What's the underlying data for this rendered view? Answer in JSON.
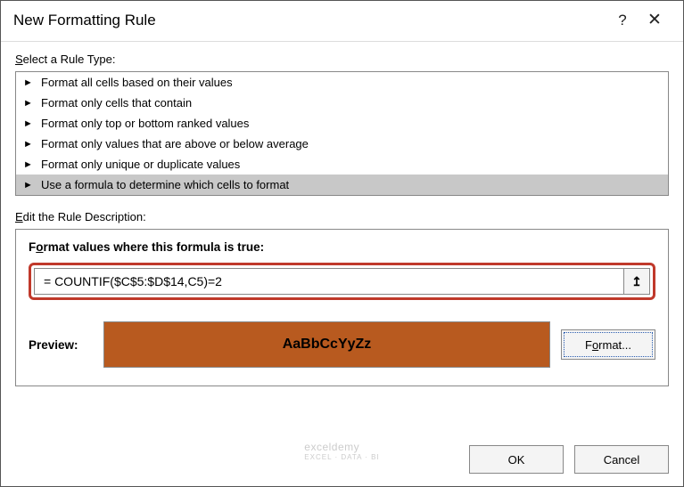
{
  "dialog": {
    "title": "New Formatting Rule",
    "help_symbol": "?",
    "close_symbol": "✕"
  },
  "rule_type": {
    "label_pre": "S",
    "label_post": "elect a Rule Type:",
    "items": [
      "Format all cells based on their values",
      "Format only cells that contain",
      "Format only top or bottom ranked values",
      "Format only values that are above or below average",
      "Format only unique or duplicate values",
      "Use a formula to determine which cells to format"
    ],
    "selected_index": 5
  },
  "rule_desc": {
    "label_pre": "E",
    "label_post": "dit the Rule Description:",
    "formula_label_pre": "F",
    "formula_label_mid": "o",
    "formula_label_post": "rmat values where this formula is true:",
    "formula_value": "= COUNTIF($C$5:$D$14,C5)=2",
    "range_icon": "↥"
  },
  "preview": {
    "label": "Preview:",
    "sample_text": "AaBbCcYyZz",
    "swatch_color": "#b85a1f",
    "format_btn_pre": "F",
    "format_btn_mid": "o",
    "format_btn_post": "rmat..."
  },
  "footer": {
    "ok": "OK",
    "cancel": "Cancel",
    "watermark": "exceldemy",
    "watermark_sub": "EXCEL · DATA · BI"
  }
}
